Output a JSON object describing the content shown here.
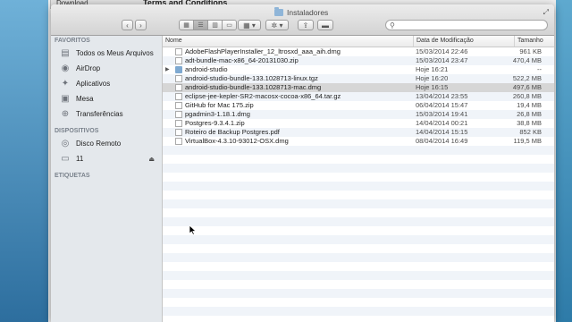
{
  "background_window": {
    "tab_label": "Download",
    "title": "Terms and Conditions"
  },
  "window": {
    "title": "Instaladores",
    "search_placeholder": ""
  },
  "sidebar": {
    "sections": [
      {
        "heading": "FAVORITOS",
        "items": [
          {
            "label": "Todos os Meus Arquivos",
            "icon": "all-files-icon"
          },
          {
            "label": "AirDrop",
            "icon": "airdrop-icon"
          },
          {
            "label": "Aplicativos",
            "icon": "applications-icon"
          },
          {
            "label": "Mesa",
            "icon": "desktop-icon"
          },
          {
            "label": "Transferências",
            "icon": "downloads-icon"
          }
        ]
      },
      {
        "heading": "DISPOSITIVOS",
        "items": [
          {
            "label": "Disco Remoto",
            "icon": "remote-disc-icon"
          },
          {
            "label": "11",
            "icon": "drive-icon",
            "eject": true
          }
        ]
      },
      {
        "heading": "ETIQUETAS",
        "items": []
      }
    ]
  },
  "columns": {
    "name": "Nome",
    "date": "Data de Modificação",
    "size": "Tamanho"
  },
  "files": [
    {
      "name": "AdobeFlashPlayerInstaller_12_ltrosxd_aaa_aih.dmg",
      "date": "15/03/2014 22:46",
      "size": "961 KB",
      "kind": "file"
    },
    {
      "name": "adt-bundle-mac-x86_64-20131030.zip",
      "date": "15/03/2014 23:47",
      "size": "470,4 MB",
      "kind": "file"
    },
    {
      "name": "android-studio",
      "date": "Hoje 16:21",
      "size": "--",
      "kind": "folder"
    },
    {
      "name": "android-studio-bundle-133.1028713-linux.tgz",
      "date": "Hoje 16:20",
      "size": "522,2 MB",
      "kind": "file"
    },
    {
      "name": "android-studio-bundle-133.1028713-mac.dmg",
      "date": "Hoje 16:15",
      "size": "497,6 MB",
      "kind": "file",
      "selected": true
    },
    {
      "name": "eclipse-jee-kepler-SR2-macosx-cocoa-x86_64.tar.gz",
      "date": "13/04/2014 23:55",
      "size": "260,8 MB",
      "kind": "file"
    },
    {
      "name": "GitHub for Mac 175.zip",
      "date": "06/04/2014 15:47",
      "size": "19,4 MB",
      "kind": "file"
    },
    {
      "name": "pgadmin3-1.18.1.dmg",
      "date": "15/03/2014 19:41",
      "size": "26,8 MB",
      "kind": "file"
    },
    {
      "name": "Postgres-9.3.4.1.zip",
      "date": "14/04/2014 00:21",
      "size": "38,8 MB",
      "kind": "file"
    },
    {
      "name": "Roteiro de Backup Postgres.pdf",
      "date": "14/04/2014 15:15",
      "size": "852 KB",
      "kind": "file"
    },
    {
      "name": "VirtualBox-4.3.10-93012-OSX.dmg",
      "date": "08/04/2014 16:49",
      "size": "119,5 MB",
      "kind": "file"
    }
  ]
}
